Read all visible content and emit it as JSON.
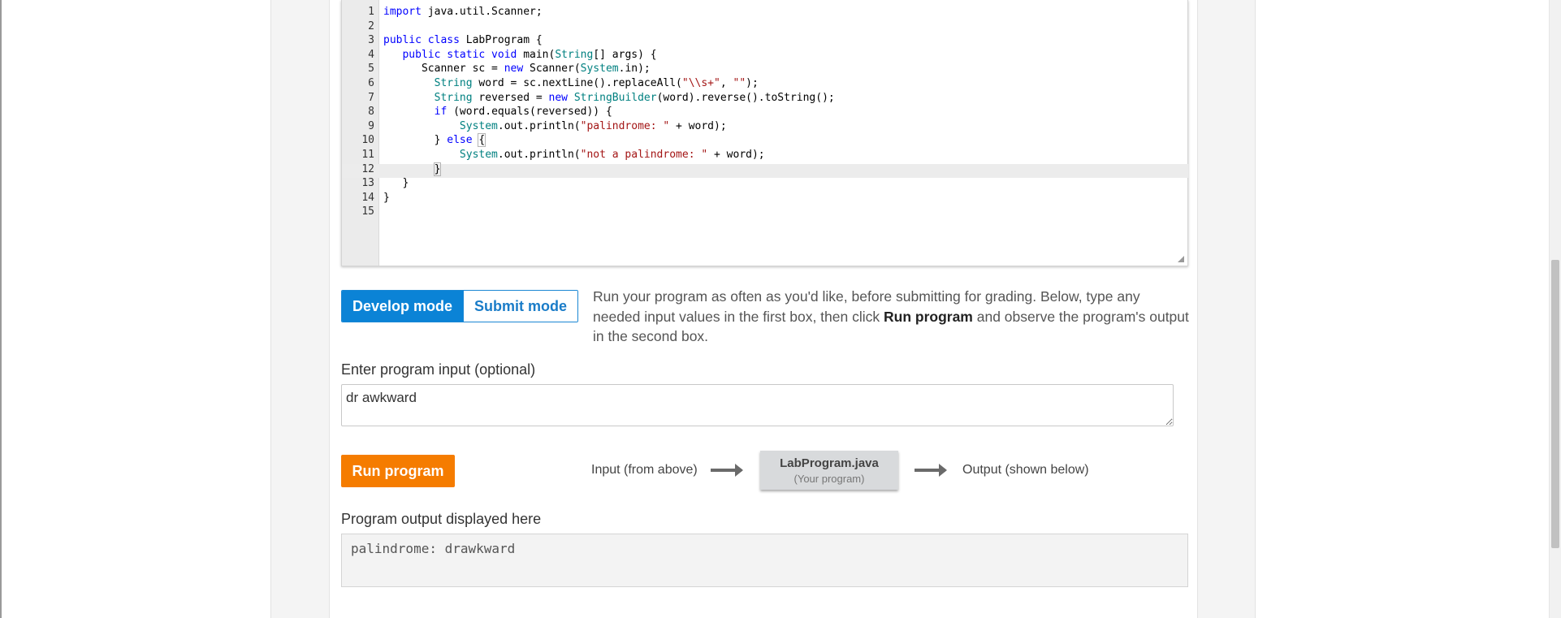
{
  "editor": {
    "lines": [
      {
        "n": "1",
        "segments": [
          {
            "t": "import",
            "c": "kw"
          },
          {
            "t": " java.util.Scanner;",
            "c": ""
          }
        ]
      },
      {
        "n": "2",
        "segments": []
      },
      {
        "n": "3",
        "segments": [
          {
            "t": "public class",
            "c": "kw"
          },
          {
            "t": " LabProgram {",
            "c": ""
          }
        ]
      },
      {
        "n": "4",
        "segments": [
          {
            "t": "   ",
            "c": ""
          },
          {
            "t": "public static void",
            "c": "kw"
          },
          {
            "t": " main(",
            "c": ""
          },
          {
            "t": "String",
            "c": "ty"
          },
          {
            "t": "[] args) {",
            "c": ""
          }
        ]
      },
      {
        "n": "5",
        "segments": [
          {
            "t": "      Scanner sc = ",
            "c": ""
          },
          {
            "t": "new",
            "c": "kw"
          },
          {
            "t": " Scanner(",
            "c": ""
          },
          {
            "t": "System",
            "c": "ty"
          },
          {
            "t": ".in);",
            "c": ""
          }
        ]
      },
      {
        "n": "6",
        "segments": [
          {
            "t": "        ",
            "c": ""
          },
          {
            "t": "String",
            "c": "ty"
          },
          {
            "t": " word = sc.nextLine().replaceAll(",
            "c": ""
          },
          {
            "t": "\"\\\\s+\"",
            "c": "st"
          },
          {
            "t": ", ",
            "c": ""
          },
          {
            "t": "\"\"",
            "c": "st"
          },
          {
            "t": ");",
            "c": ""
          }
        ]
      },
      {
        "n": "7",
        "segments": [
          {
            "t": "        ",
            "c": ""
          },
          {
            "t": "String",
            "c": "ty"
          },
          {
            "t": " reversed = ",
            "c": ""
          },
          {
            "t": "new",
            "c": "kw"
          },
          {
            "t": " ",
            "c": ""
          },
          {
            "t": "StringBuilder",
            "c": "ty"
          },
          {
            "t": "(word).reverse().toString();",
            "c": ""
          }
        ]
      },
      {
        "n": "8",
        "segments": [
          {
            "t": "        ",
            "c": ""
          },
          {
            "t": "if",
            "c": "kw"
          },
          {
            "t": " (word.equals(reversed)) {",
            "c": ""
          }
        ]
      },
      {
        "n": "9",
        "segments": [
          {
            "t": "            ",
            "c": ""
          },
          {
            "t": "System",
            "c": "ty"
          },
          {
            "t": ".out.println(",
            "c": ""
          },
          {
            "t": "\"palindrome: \"",
            "c": "st"
          },
          {
            "t": " + word);",
            "c": ""
          }
        ]
      },
      {
        "n": "10",
        "segments": [
          {
            "t": "        } ",
            "c": ""
          },
          {
            "t": "else",
            "c": "kw"
          },
          {
            "t": " ",
            "c": ""
          },
          {
            "t": "{",
            "c": "bracket-match"
          }
        ]
      },
      {
        "n": "11",
        "segments": [
          {
            "t": "            ",
            "c": ""
          },
          {
            "t": "System",
            "c": "ty"
          },
          {
            "t": ".out.println(",
            "c": ""
          },
          {
            "t": "\"not a palindrome: \"",
            "c": "st"
          },
          {
            "t": " + word);",
            "c": ""
          }
        ]
      },
      {
        "n": "12",
        "segments": [
          {
            "t": "        ",
            "c": ""
          },
          {
            "t": "}",
            "c": "bracket-match"
          }
        ]
      },
      {
        "n": "13",
        "segments": [
          {
            "t": "   }",
            "c": ""
          }
        ]
      },
      {
        "n": "14",
        "segments": [
          {
            "t": "}",
            "c": ""
          }
        ]
      },
      {
        "n": "15",
        "segments": []
      }
    ]
  },
  "mode": {
    "develop_label": "Develop mode",
    "submit_label": "Submit mode",
    "active": "develop"
  },
  "instructions": {
    "before": "Run your program as often as you'd like, before submitting for grading. Below, type any needed input values in the first box, then click ",
    "bold": "Run program",
    "after": " and observe the program's output in the second box."
  },
  "input": {
    "label": "Enter program input (optional)",
    "value": "dr awkward"
  },
  "run": {
    "button_label": "Run program",
    "flow_input_label": "Input (from above)",
    "program_name": "LabProgram.java",
    "program_sub": "(Your program)",
    "flow_output_label": "Output (shown below)"
  },
  "output": {
    "label": "Program output displayed here",
    "value": "palindrome: drawkward"
  },
  "colors": {
    "accent_blue": "#0b83d6",
    "run_orange": "#f57c00"
  }
}
